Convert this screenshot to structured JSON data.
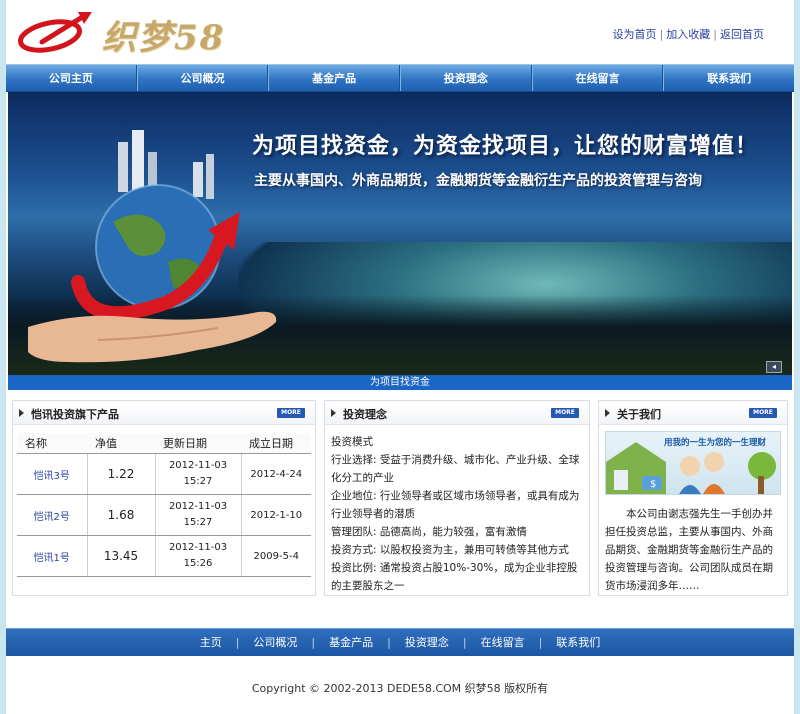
{
  "header": {
    "logo_text": "织梦58",
    "toplinks": [
      "设为首页",
      "加入收藏",
      "返回首页"
    ]
  },
  "nav": [
    "公司主页",
    "公司概况",
    "基金产品",
    "投资理念",
    "在线留言",
    "联系我们"
  ],
  "banner": {
    "title": "为项目找资金，为资金找项目，让您的财富增值！",
    "subtitle": "主要从事国内、外商品期货，金融期货等金融衍生产品的投资管理与咨询",
    "caption": "为项目找资金"
  },
  "panels": {
    "funds": {
      "title": "恺讯投资旗下产品",
      "more": "MORE",
      "headers": [
        "名称",
        "净值",
        "更新日期",
        "成立日期"
      ],
      "rows": [
        {
          "name": "恺讯3号",
          "nav": "1.22",
          "date": "2012-11-03",
          "time": "15:27",
          "est": "2012-4-24"
        },
        {
          "name": "恺讯2号",
          "nav": "1.68",
          "date": "2012-11-03",
          "time": "15:27",
          "est": "2012-1-10"
        },
        {
          "name": "恺讯1号",
          "nav": "13.45",
          "date": "2012-11-03",
          "time": "15:26",
          "est": "2009-5-4"
        }
      ]
    },
    "philosophy": {
      "title": "投资理念",
      "more": "MORE",
      "lines": [
        "投资模式",
        "行业选择: 受益于消费升级、城市化、产业升级、全球化分工的产业",
        "企业地位: 行业领导者或区域市场领导者，或具有成为行业领导者的潜质",
        "管理团队: 品德高尚，能力较强，富有激情",
        "投资方式: 以股权投资为主，兼用可转债等其他方式",
        "投资比例: 通常投资占股10%-30%，成为企业非控股的主要股东之一"
      ]
    },
    "about": {
      "title": "关于我们",
      "more": "MORE",
      "image_slogan": "用我的一生为您的一生理财",
      "text": "本公司由谢志强先生一手创办并担任投资总监，主要从事国内、外商品期货、金融期货等金融衍生产品的投资管理与咨询。公司团队成员在期货市场浸润多年……"
    }
  },
  "footer": {
    "links": [
      "主页",
      "公司概况",
      "基金产品",
      "投资理念",
      "在线留言",
      "联系我们"
    ],
    "copyright": "Copyright © 2002-2013 DEDE58.COM 织梦58 版权所有"
  },
  "colors": {
    "nav": "#2f74c4",
    "caption_bar": "#1a66c4",
    "link": "#2a3fa0",
    "more_button": "#2558b5",
    "page_bg": "#c9e6ef"
  }
}
